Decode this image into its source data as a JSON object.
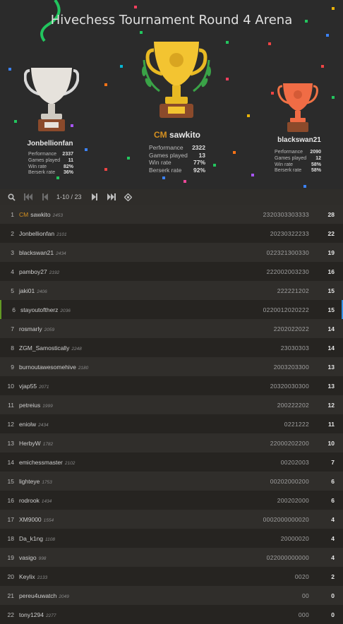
{
  "tournament": {
    "title": "Hivechess Tournament Round 4 Arena"
  },
  "stat_labels": {
    "performance": "Performance",
    "games": "Games played",
    "winrate": "Win rate",
    "berserk": "Berserk rate"
  },
  "podium": {
    "first": {
      "title": "CM",
      "name": "sawkito",
      "performance": "2322",
      "games": "13",
      "winrate": "77%",
      "berserk": "92%"
    },
    "second": {
      "name": "Jonbellionfan",
      "performance": "2337",
      "games": "11",
      "winrate": "82%",
      "berserk": "36%"
    },
    "third": {
      "name": "blackswan21",
      "performance": "2090",
      "games": "12",
      "winrate": "58%",
      "berserk": "58%"
    }
  },
  "pager": {
    "info": "1-10 / 23"
  },
  "colors": {
    "accent_green": "#629924",
    "accent_blue": "#3692e7",
    "title_gold": "#d59020"
  },
  "standings": [
    {
      "rank": "1",
      "title": "CM",
      "name": "sawkito",
      "rating": "2453",
      "sheet": "2320303303333",
      "total": "28"
    },
    {
      "rank": "2",
      "name": "Jonbellionfan",
      "rating": "2101",
      "sheet": "20230322233",
      "total": "22"
    },
    {
      "rank": "3",
      "name": "blackswan21",
      "rating": "2434",
      "sheet": "022321300330",
      "total": "19"
    },
    {
      "rank": "4",
      "name": "pamboy27",
      "rating": "2192",
      "sheet": "222002003230",
      "total": "16"
    },
    {
      "rank": "5",
      "name": "jaki01",
      "rating": "2406",
      "sheet": "222221202",
      "total": "15"
    },
    {
      "rank": "6",
      "name": "stayoutoftherz",
      "rating": "2036",
      "sheet": "0220012020222",
      "total": "15"
    },
    {
      "rank": "7",
      "name": "rosmarly",
      "rating": "2059",
      "sheet": "2202022022",
      "total": "14"
    },
    {
      "rank": "8",
      "name": "ZGM_Samostically",
      "rating": "2248",
      "sheet": "23030303",
      "total": "14"
    },
    {
      "rank": "9",
      "name": "burnoutawesomehive",
      "rating": "2180",
      "sheet": "2003203300",
      "total": "13"
    },
    {
      "rank": "10",
      "name": "vjap55",
      "rating": "2071",
      "sheet": "20320030300",
      "total": "13"
    },
    {
      "rank": "11",
      "name": "petreius",
      "rating": "1999",
      "sheet": "200222202",
      "total": "12"
    },
    {
      "rank": "12",
      "name": "eniolw",
      "rating": "2434",
      "sheet": "0221222",
      "total": "11"
    },
    {
      "rank": "13",
      "name": "HerbyW",
      "rating": "1782",
      "sheet": "22000202200",
      "total": "10"
    },
    {
      "rank": "14",
      "name": "emichessmaster",
      "rating": "2102",
      "sheet": "00202003",
      "total": "7"
    },
    {
      "rank": "15",
      "name": "lighteye",
      "rating": "1753",
      "sheet": "00202000200",
      "total": "6"
    },
    {
      "rank": "16",
      "name": "rodrook",
      "rating": "1434",
      "sheet": "200202000",
      "total": "6"
    },
    {
      "rank": "17",
      "name": "XM9000",
      "rating": "1554",
      "sheet": "0002000000020",
      "total": "4"
    },
    {
      "rank": "18",
      "name": "Da_k1ng",
      "rating": "1108",
      "sheet": "20000020",
      "total": "4"
    },
    {
      "rank": "19",
      "name": "vasigo",
      "rating": "998",
      "sheet": "022000000000",
      "total": "4"
    },
    {
      "rank": "20",
      "name": "Keylix",
      "rating": "2133",
      "sheet": "0020",
      "total": "2"
    },
    {
      "rank": "21",
      "name": "pereu4uwatch",
      "rating": "2049",
      "sheet": "00",
      "total": "0"
    },
    {
      "rank": "22",
      "name": "tony1294",
      "rating": "2277",
      "sheet": "000",
      "total": "0"
    }
  ]
}
